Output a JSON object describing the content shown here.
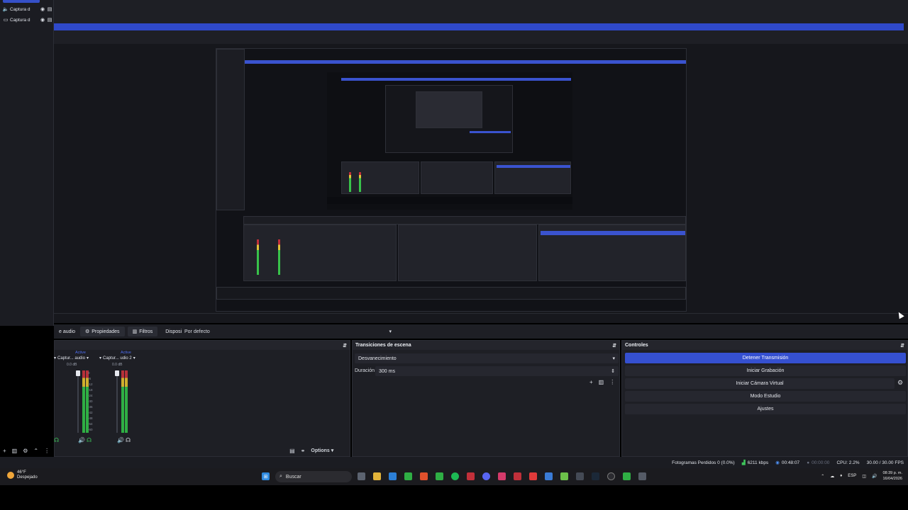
{
  "sources": {
    "items": [
      {
        "icon": "speaker-icon",
        "label": "Captura d"
      },
      {
        "icon": "monitor-icon",
        "label": "Captura d"
      }
    ]
  },
  "props_bar": {
    "audio_tab": "e audio",
    "properties": "Propiedades",
    "filters": "Filtros",
    "device_label": "Dispositivo",
    "device_value": "Por defecto"
  },
  "mixer": {
    "channels": [
      {
        "name": "Captur... audio",
        "status": "Active",
        "db": "0.0 dB",
        "level": 0.72
      },
      {
        "name": "Captur... udio 2",
        "status": "Active",
        "db": "0.0 dB",
        "level": 0.72
      }
    ],
    "scale": [
      "0",
      "-6",
      "-12",
      "-18",
      "-24",
      "-30",
      "-36",
      "-42",
      "-48",
      "-54",
      "-60"
    ],
    "options_label": "Options"
  },
  "transitions": {
    "title": "Transiciones de escena",
    "selected": "Desvanecimiento",
    "duration_label": "Duración",
    "duration_value": "300 ms"
  },
  "controls": {
    "title": "Controles",
    "buttons": [
      {
        "label": "Detener Transmisión",
        "active": true
      },
      {
        "label": "Iniciar Grabación",
        "active": false
      },
      {
        "label": "Iniciar Cámara Virtual",
        "active": false
      },
      {
        "label": "Modo Estudio",
        "active": false
      },
      {
        "label": "Ajustes",
        "active": false
      }
    ]
  },
  "status": {
    "dropped_frames": "Fotogramas Perdidos 0 (0.0%)",
    "bitrate": "6211 kbps",
    "stream_time": "00:48:07",
    "rec_time": "00:00:00",
    "cpu": "CPU: 2.2%",
    "fps": "30.00 / 30.00 FPS"
  },
  "taskbar": {
    "temp": "46°F",
    "weather": "Despejado",
    "search_placeholder": "Buscar",
    "lang": "ESP",
    "time": "08:39 p. m.",
    "date": "16/04/2026"
  },
  "colors": {
    "accent": "#3550d0",
    "panel": "#1e1f25",
    "background": "#000000"
  }
}
